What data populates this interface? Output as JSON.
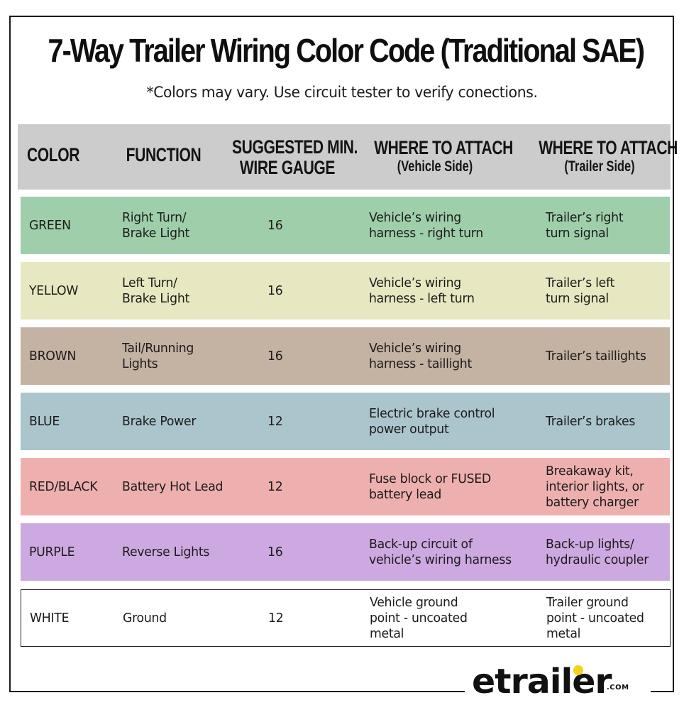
{
  "title": "7-Way Trailer Wiring Color Code (Traditional SAE)",
  "subtitle": "*Colors may vary. Use circuit tester to verify conections.",
  "table": {
    "headers": {
      "color": "COLOR",
      "function": "FUNCTION",
      "gauge_line1": "SUGGESTED MIN.",
      "gauge_line2": "WIRE GAUGE",
      "vehicle_main": "WHERE TO ATTACH",
      "vehicle_sub": "(Vehicle Side)",
      "trailer_main": "WHERE TO ATTACH",
      "trailer_sub": "(Trailer Side)"
    },
    "rows": [
      {
        "color": "GREEN",
        "bg": "#9fcfaa",
        "function": [
          "Right Turn/",
          "Brake Light"
        ],
        "gauge": "16",
        "vehicle": [
          "Vehicle’s wiring",
          "harness - right turn"
        ],
        "trailer": [
          "Trailer’s right",
          "turn signal"
        ]
      },
      {
        "color": "YELLOW",
        "bg": "#e7e8c1",
        "function": [
          "Left Turn/",
          "Brake Light"
        ],
        "gauge": "16",
        "vehicle": [
          "Vehicle’s wiring",
          "harness - left turn"
        ],
        "trailer": [
          "Trailer’s left",
          "turn signal"
        ]
      },
      {
        "color": "BROWN",
        "bg": "#c4b2a3",
        "function": [
          "Tail/Running",
          "Lights"
        ],
        "gauge": "16",
        "vehicle": [
          "Vehicle’s wiring",
          "harness - taillight"
        ],
        "trailer": [
          "Trailer’s taillights"
        ]
      },
      {
        "color": "BLUE",
        "bg": "#abc5cc",
        "function": [
          "Brake Power"
        ],
        "gauge": "12",
        "vehicle": [
          "Electric brake control",
          "power output"
        ],
        "trailer": [
          "Trailer’s brakes"
        ]
      },
      {
        "color": "RED/BLACK",
        "bg": "#eeb0ae",
        "function": [
          "Battery Hot Lead"
        ],
        "gauge": "12",
        "vehicle": [
          "Fuse block or FUSED",
          "battery lead"
        ],
        "trailer": [
          "Breakaway kit,",
          "interior lights, or",
          "battery charger"
        ]
      },
      {
        "color": "PURPLE",
        "bg": "#cda9e1",
        "function": [
          "Reverse Lights"
        ],
        "gauge": "16",
        "vehicle": [
          "Back-up circuit of",
          "vehicle’s wiring harness"
        ],
        "trailer": [
          "Back-up lights/",
          "hydraulic coupler"
        ]
      },
      {
        "color": "WHITE",
        "bg": "#ffffff",
        "bordered": true,
        "function": [
          "Ground"
        ],
        "gauge": "12",
        "vehicle": [
          "Vehicle ground",
          "point - uncoated",
          "metal"
        ],
        "trailer": [
          "Trailer ground",
          "point - uncoated",
          "metal"
        ]
      }
    ]
  },
  "logo": {
    "word": "etrailer",
    "suffix": ".COM",
    "dot_color": "#f3d21a"
  }
}
